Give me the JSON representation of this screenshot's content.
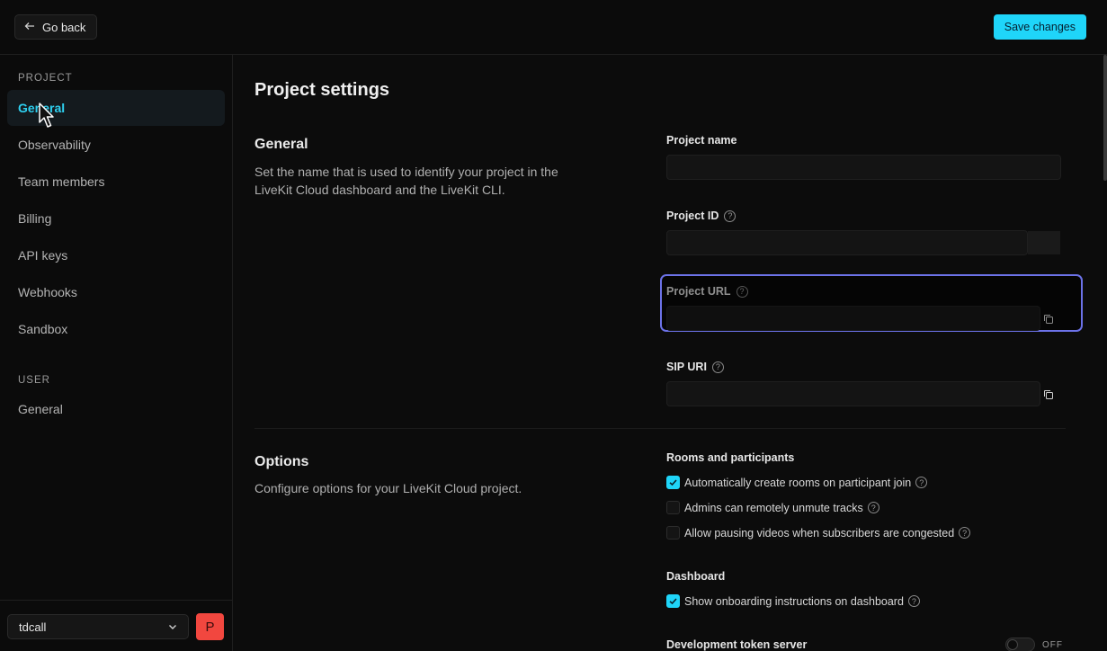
{
  "header": {
    "back_label": "Go back",
    "save_label": "Save changes"
  },
  "sidebar": {
    "project_label": "PROJECT",
    "project_items": [
      {
        "label": "General"
      },
      {
        "label": "Observability"
      },
      {
        "label": "Team members"
      },
      {
        "label": "Billing"
      },
      {
        "label": "API keys"
      },
      {
        "label": "Webhooks"
      },
      {
        "label": "Sandbox"
      }
    ],
    "user_label": "USER",
    "user_items": [
      {
        "label": "General"
      }
    ],
    "project_selector": "tdcall",
    "avatar_letter": "P"
  },
  "main": {
    "title": "Project settings",
    "general": {
      "title": "General",
      "description": "Set the name that is used to identify your project in the LiveKit Cloud dashboard and the LiveKit CLI.",
      "fields": {
        "project_name": {
          "label": "Project name",
          "value": ""
        },
        "project_id": {
          "label": "Project ID",
          "value": ""
        },
        "project_url": {
          "label": "Project URL",
          "value": ""
        },
        "sip_uri": {
          "label": "SIP URI",
          "value": ""
        }
      }
    },
    "options": {
      "title": "Options",
      "description": "Configure options for your LiveKit Cloud project.",
      "rooms_label": "Rooms and participants",
      "rooms": [
        {
          "label": "Automatically create rooms on participant join",
          "checked": true
        },
        {
          "label": "Admins can remotely unmute tracks",
          "checked": false
        },
        {
          "label": "Allow pausing videos when subscribers are congested",
          "checked": false
        }
      ],
      "dashboard_label": "Dashboard",
      "dashboard": [
        {
          "label": "Show onboarding instructions on dashboard",
          "checked": true
        }
      ],
      "dev_token_label": "Development token server",
      "dev_token_state": "OFF"
    }
  },
  "colors": {
    "accent": "#1fd5f9",
    "focus": "#6c72e8",
    "avatar": "#f2473f"
  }
}
